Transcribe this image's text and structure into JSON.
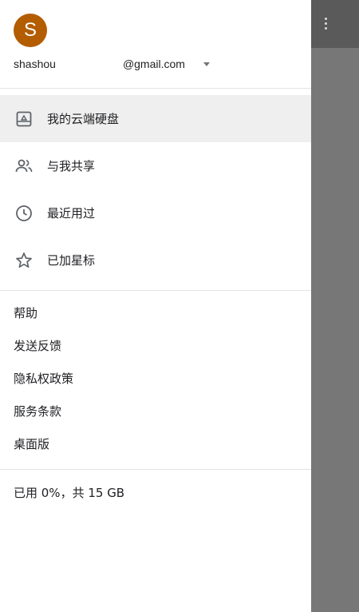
{
  "account": {
    "avatar_letter": "S",
    "avatar_color": "#b35c00",
    "email_user": "shashou",
    "email_domain": "@gmail.com"
  },
  "nav": {
    "items": [
      {
        "label": "我的云端硬盘",
        "icon": "drive-icon",
        "active": true
      },
      {
        "label": "与我共享",
        "icon": "people-icon",
        "active": false
      },
      {
        "label": "最近用过",
        "icon": "clock-icon",
        "active": false
      },
      {
        "label": "已加星标",
        "icon": "star-icon",
        "active": false
      }
    ]
  },
  "links": {
    "items": [
      {
        "label": "帮助"
      },
      {
        "label": "发送反馈"
      },
      {
        "label": "隐私权政策"
      },
      {
        "label": "服务条款"
      },
      {
        "label": "桌面版"
      }
    ]
  },
  "storage": {
    "text": "已用 0%，共 15 GB"
  },
  "colors": {
    "overlay": "#777777",
    "active_item": "#efefef",
    "text": "#202124"
  }
}
